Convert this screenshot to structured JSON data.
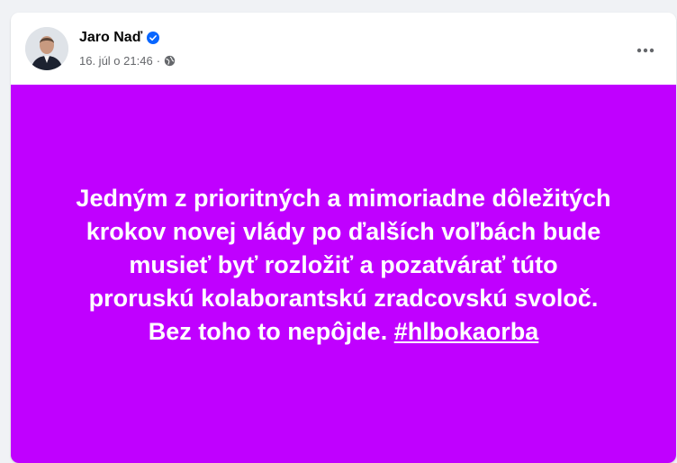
{
  "post": {
    "author": "Jaro Naď",
    "verified_icon": "verified-badge-icon",
    "timestamp": "16. júl o 21:46",
    "separator": "·",
    "audience_icon": "globe-icon",
    "more_icon": "more-options-icon",
    "background_color": "#c000ff",
    "text_lines": [
      "Jedným z prioritných a mimoriadne dôležitých",
      "krokov novej vlády po ďalších voľbách bude",
      "musieť byť rozložiť a pozatvárať túto",
      "proruskú kolaborantskú zradcovskú svoloč.",
      "Bez toho to nepôjde."
    ],
    "hashtag": "#hlbokaorba"
  }
}
